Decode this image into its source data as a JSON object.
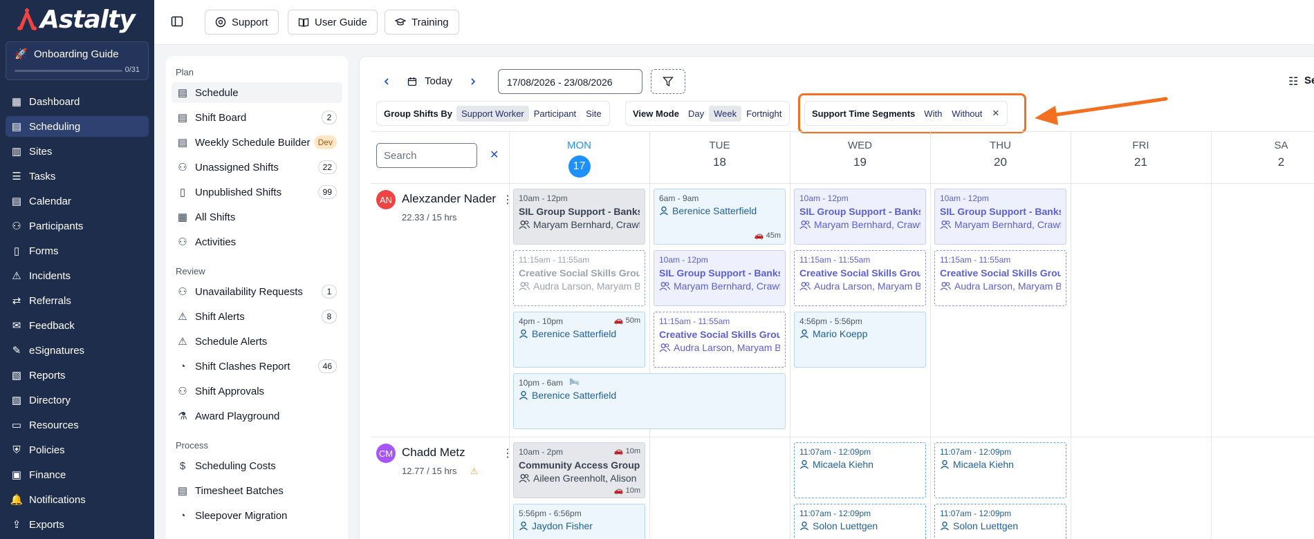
{
  "brand": {
    "name": "Astalty"
  },
  "onboarding": {
    "title": "Onboarding Guide",
    "progress": "0/31",
    "progress_fraction": 0
  },
  "nav": {
    "items": [
      {
        "label": "Dashboard",
        "icon": "grid-icon",
        "active": false
      },
      {
        "label": "Scheduling",
        "icon": "calendar-icon",
        "active": true
      },
      {
        "label": "Sites",
        "icon": "building-icon",
        "active": false
      },
      {
        "label": "Tasks",
        "icon": "list-icon",
        "active": false
      },
      {
        "label": "Calendar",
        "icon": "calendar-icon",
        "active": false
      },
      {
        "label": "Participants",
        "icon": "users-icon",
        "active": false
      },
      {
        "label": "Forms",
        "icon": "book-icon",
        "active": false
      },
      {
        "label": "Incidents",
        "icon": "warning-icon",
        "active": false
      },
      {
        "label": "Referrals",
        "icon": "referral-icon",
        "active": false
      },
      {
        "label": "Feedback",
        "icon": "feedback-icon",
        "active": false
      },
      {
        "label": "eSignatures",
        "icon": "pen-icon",
        "active": false
      },
      {
        "label": "Reports",
        "icon": "report-icon",
        "active": false
      },
      {
        "label": "Directory",
        "icon": "directory-icon",
        "active": false
      },
      {
        "label": "Resources",
        "icon": "folder-icon",
        "active": false
      },
      {
        "label": "Policies",
        "icon": "shield-icon",
        "active": false
      },
      {
        "label": "Finance",
        "icon": "finance-icon",
        "active": false
      },
      {
        "label": "Notifications",
        "icon": "bell-icon",
        "active": false
      },
      {
        "label": "Exports",
        "icon": "export-icon",
        "active": false
      }
    ]
  },
  "header": {
    "buttons": [
      {
        "label": "Support",
        "icon": "support-icon"
      },
      {
        "label": "User Guide",
        "icon": "book-open-icon"
      },
      {
        "label": "Training",
        "icon": "graduation-icon"
      }
    ]
  },
  "subnav": {
    "sections": [
      {
        "heading": "Plan",
        "items": [
          {
            "label": "Schedule",
            "active": true,
            "badge": ""
          },
          {
            "label": "Shift Board",
            "badge": "2"
          },
          {
            "label": "Weekly Schedule Builder",
            "badge": "Dev",
            "badge_type": "dev"
          },
          {
            "label": "Unassigned Shifts",
            "badge": "22"
          },
          {
            "label": "Unpublished Shifts",
            "badge": "99"
          },
          {
            "label": "All Shifts",
            "badge": ""
          },
          {
            "label": "Activities",
            "badge": ""
          }
        ]
      },
      {
        "heading": "Review",
        "items": [
          {
            "label": "Unavailability Requests",
            "badge": "1"
          },
          {
            "label": "Shift Alerts",
            "badge": "8"
          },
          {
            "label": "Schedule Alerts",
            "badge": ""
          },
          {
            "label": "Shift Clashes Report",
            "badge": "46"
          },
          {
            "label": "Shift Approvals",
            "badge": ""
          },
          {
            "label": "Award Playground",
            "badge": ""
          }
        ]
      },
      {
        "heading": "Process",
        "items": [
          {
            "label": "Scheduling Costs",
            "badge": ""
          },
          {
            "label": "Timesheet Batches",
            "badge": ""
          },
          {
            "label": "Sleepover Migration",
            "badge": ""
          }
        ]
      }
    ]
  },
  "toolbar": {
    "today_label": "Today",
    "date_range": "17/08/2026 - 23/08/2026",
    "group_by": {
      "title": "Group Shifts By",
      "options": [
        "Support Worker",
        "Participant",
        "Site"
      ],
      "selected": "Support Worker"
    },
    "view_mode": {
      "title": "View Mode",
      "options": [
        "Day",
        "Week",
        "Fortnight"
      ],
      "selected": "Week"
    },
    "segments": {
      "title": "Support Time Segments",
      "options": [
        "With",
        "Without"
      ]
    },
    "settings_label": "Se"
  },
  "calendar": {
    "search_placeholder": "Search",
    "days": [
      {
        "name": "MON",
        "num": "17",
        "today": true
      },
      {
        "name": "TUE",
        "num": "18",
        "today": false
      },
      {
        "name": "WED",
        "num": "19",
        "today": false
      },
      {
        "name": "THU",
        "num": "20",
        "today": false
      },
      {
        "name": "FRI",
        "num": "21",
        "today": false
      },
      {
        "name": "SA",
        "num": "2",
        "today": false
      }
    ],
    "people": [
      {
        "initials": "AN",
        "name": "Alexzander Nader",
        "hours": "22.33 / 15 hrs",
        "avatar_color": "#ef4444"
      },
      {
        "initials": "CM",
        "name": "Chadd Metz",
        "hours": "12.77 / 15 hrs",
        "avatar_color": "#a855f7"
      }
    ],
    "shifts": [
      {
        "style": "s-grey",
        "time": "10am - 12pm",
        "title": "SIL Group Support - Banksia",
        "who": "Maryam Bernhard, Crawford",
        "group": true
      },
      {
        "style": "s-blue",
        "time": "6am - 9am",
        "title": "",
        "who": "Berenice Satterfield",
        "group": false,
        "travel": "45m"
      },
      {
        "style": "s-purple",
        "time": "10am - 12pm",
        "title": "SIL Group Support - Banksia",
        "who": "Maryam Bernhard, Crawford",
        "group": true
      },
      {
        "style": "s-purple",
        "time": "10am - 12pm",
        "title": "SIL Group Support - Banksia",
        "who": "Maryam Bernhard, Crawford",
        "group": true
      },
      {
        "style": "s-dash-grey",
        "time": "11:15am - 11:55am",
        "title": "Creative Social Skills Group",
        "who": "Audra Larson, Maryam Bernhard",
        "group": true
      },
      {
        "style": "s-purple",
        "time": "10am - 12pm",
        "title": "SIL Group Support - Banksia",
        "who": "Maryam Bernhard, Crawford",
        "group": true
      },
      {
        "style": "s-dash-purple",
        "time": "11:15am - 11:55am",
        "title": "Creative Social Skills Group",
        "who": "Audra Larson, Maryam Bernhard",
        "group": true
      },
      {
        "style": "s-dash-purple",
        "time": "11:15am - 11:55am",
        "title": "Creative Social Skills Group",
        "who": "Audra Larson, Maryam Bernhard",
        "group": true
      },
      {
        "style": "s-blue",
        "time": "4pm - 10pm",
        "title": "",
        "who": "Berenice Satterfield",
        "group": false,
        "travel": "50m"
      },
      {
        "style": "s-dash-purple",
        "time": "11:15am - 11:55am",
        "title": "Creative Social Skills Group",
        "who": "Audra Larson, Maryam Bernhard",
        "group": true
      },
      {
        "style": "s-blue",
        "time": "4:56pm - 5:56pm",
        "title": "",
        "who": "Mario Koepp",
        "group": false
      },
      {
        "style": "s-blue",
        "time": "10pm - 6am",
        "title": "",
        "who": "Berenice Satterfield",
        "group": false,
        "sleepover": true
      },
      {
        "style": "s-grey",
        "time": "10am - 2pm",
        "title": "Community Access Group Support",
        "who": "Aileen Greenholt, Alison",
        "group": true,
        "travel": "10m",
        "travel2": "10m"
      },
      {
        "style": "s-dash-blue",
        "time": "11:07am - 12:09pm",
        "title": "",
        "who": "Micaela Kiehn",
        "group": false
      },
      {
        "style": "s-dash-blue",
        "time": "11:07am - 12:09pm",
        "title": "",
        "who": "Micaela Kiehn",
        "group": false
      },
      {
        "style": "s-blue",
        "time": "5:56pm - 6:56pm",
        "title": "",
        "who": "Jaydon Fisher",
        "group": false
      },
      {
        "style": "s-dash-blue",
        "time": "11:07am - 12:09pm",
        "title": "",
        "who": "Solon Luettgen",
        "group": false
      },
      {
        "style": "s-dash-blue",
        "time": "11:07am - 12:09pm",
        "title": "",
        "who": "Solon Luettgen",
        "group": false
      }
    ]
  },
  "colors": {
    "sidebar": "#1e2d4b",
    "accent": "#1e90ff",
    "highlight": "#f37021"
  }
}
